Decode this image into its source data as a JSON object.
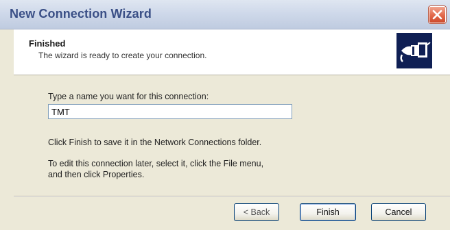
{
  "window": {
    "title": "New Connection Wizard"
  },
  "header": {
    "title": "Finished",
    "subtitle": "The wizard is ready to create your connection.",
    "icon": "network-connection-icon"
  },
  "form": {
    "name_label": "Type a name you want for this connection:",
    "name_value": "TMT"
  },
  "info": {
    "line1": "Click Finish to save it in the Network Connections folder.",
    "line2": "To edit this connection later, select it, click the File menu,",
    "line3": "and then click Properties."
  },
  "buttons": {
    "back": "< Back",
    "finish": "Finish",
    "cancel": "Cancel"
  },
  "colors": {
    "title_text": "#3a4f86",
    "close_button": "#e2684a",
    "header_icon_bg": "#0f1f54",
    "dialog_bg": "#ece9d8"
  }
}
